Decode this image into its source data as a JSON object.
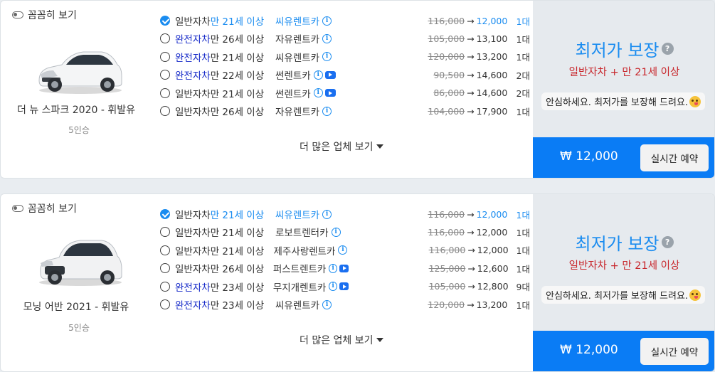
{
  "cards": [
    {
      "toggle_label": "꼼꼼히 보기",
      "car_name": "더 뉴 스파크 2020 - 휘발유",
      "seats": "5인승",
      "car_color": "#f4f5f6",
      "options": [
        {
          "insurance": "일반자차",
          "ins_type": "normal",
          "age": "만 21세 이상",
          "company": "씨유렌트카",
          "video": false,
          "old_price": "116,000",
          "new_price": "12,000",
          "count": "1대",
          "selected": true
        },
        {
          "insurance": "완전자차",
          "ins_type": "full",
          "age": "만 26세 이상",
          "company": "자유렌트카",
          "video": false,
          "old_price": "105,000",
          "new_price": "13,100",
          "count": "1대",
          "selected": false
        },
        {
          "insurance": "완전자차",
          "ins_type": "full",
          "age": "만 21세 이상",
          "company": "씨유렌트카",
          "video": false,
          "old_price": "120,000",
          "new_price": "13,200",
          "count": "1대",
          "selected": false
        },
        {
          "insurance": "완전자차",
          "ins_type": "full",
          "age": "만 22세 이상",
          "company": "썬렌트카",
          "video": true,
          "old_price": "90,500",
          "new_price": "14,600",
          "count": "2대",
          "selected": false
        },
        {
          "insurance": "일반자차",
          "ins_type": "normal",
          "age": "만 21세 이상",
          "company": "썬렌트카",
          "video": true,
          "old_price": "86,000",
          "new_price": "14,600",
          "count": "2대",
          "selected": false
        },
        {
          "insurance": "일반자차",
          "ins_type": "normal",
          "age": "만 26세 이상",
          "company": "자유렌트카",
          "video": false,
          "old_price": "104,000",
          "new_price": "17,900",
          "count": "1대",
          "selected": false
        }
      ],
      "more_label": "더 많은 업체 보기",
      "guarantee_title": "최저가 보장",
      "guarantee_condition": "일반자차 + 만 21세 이상",
      "reassure_text": "안심하세요. 최저가를 보장해 드려요.",
      "total_price": "₩ 12,000",
      "book_label": "실시간 예약"
    },
    {
      "toggle_label": "꼼꼼히 보기",
      "car_name": "모닝 어반 2021 - 휘발유",
      "seats": "5인승",
      "car_color": "#f1f2f3",
      "options": [
        {
          "insurance": "일반자차",
          "ins_type": "normal",
          "age": "만 21세 이상",
          "company": "씨유렌트카",
          "video": false,
          "old_price": "116,000",
          "new_price": "12,000",
          "count": "1대",
          "selected": true
        },
        {
          "insurance": "일반자차",
          "ins_type": "normal",
          "age": "만 21세 이상",
          "company": "로보트렌터카",
          "video": false,
          "old_price": "116,000",
          "new_price": "12,000",
          "count": "1대",
          "selected": false
        },
        {
          "insurance": "일반자차",
          "ins_type": "normal",
          "age": "만 21세 이상",
          "company": "제주사랑렌트카",
          "video": false,
          "old_price": "116,000",
          "new_price": "12,000",
          "count": "1대",
          "selected": false
        },
        {
          "insurance": "일반자차",
          "ins_type": "normal",
          "age": "만 26세 이상",
          "company": "퍼스트렌트카",
          "video": true,
          "old_price": "125,000",
          "new_price": "12,600",
          "count": "1대",
          "selected": false
        },
        {
          "insurance": "완전자차",
          "ins_type": "full",
          "age": "만 23세 이상",
          "company": "무지개렌트카",
          "video": true,
          "old_price": "105,000",
          "new_price": "12,800",
          "count": "9대",
          "selected": false
        },
        {
          "insurance": "완전자차",
          "ins_type": "full",
          "age": "만 23세 이상",
          "company": "씨유렌트카",
          "video": false,
          "old_price": "120,000",
          "new_price": "13,200",
          "count": "1대",
          "selected": false
        }
      ],
      "more_label": "더 많은 업체 보기",
      "guarantee_title": "최저가 보장",
      "guarantee_condition": "일반자차 + 만 21세 이상",
      "reassure_text": "안심하세요. 최저가를 보장해 드려요.",
      "total_price": "₩ 12,000",
      "book_label": "실시간 예약"
    }
  ],
  "colors": {
    "accent": "#1a8cf0",
    "full_coverage": "#1428c8",
    "condition": "#c8262b",
    "book_bar": "#0a7cf5"
  },
  "icons": {
    "info": "info-circle-icon",
    "video": "youtube-play-icon",
    "help": "question-circle-icon",
    "emoji": "smiling-face-icon"
  }
}
